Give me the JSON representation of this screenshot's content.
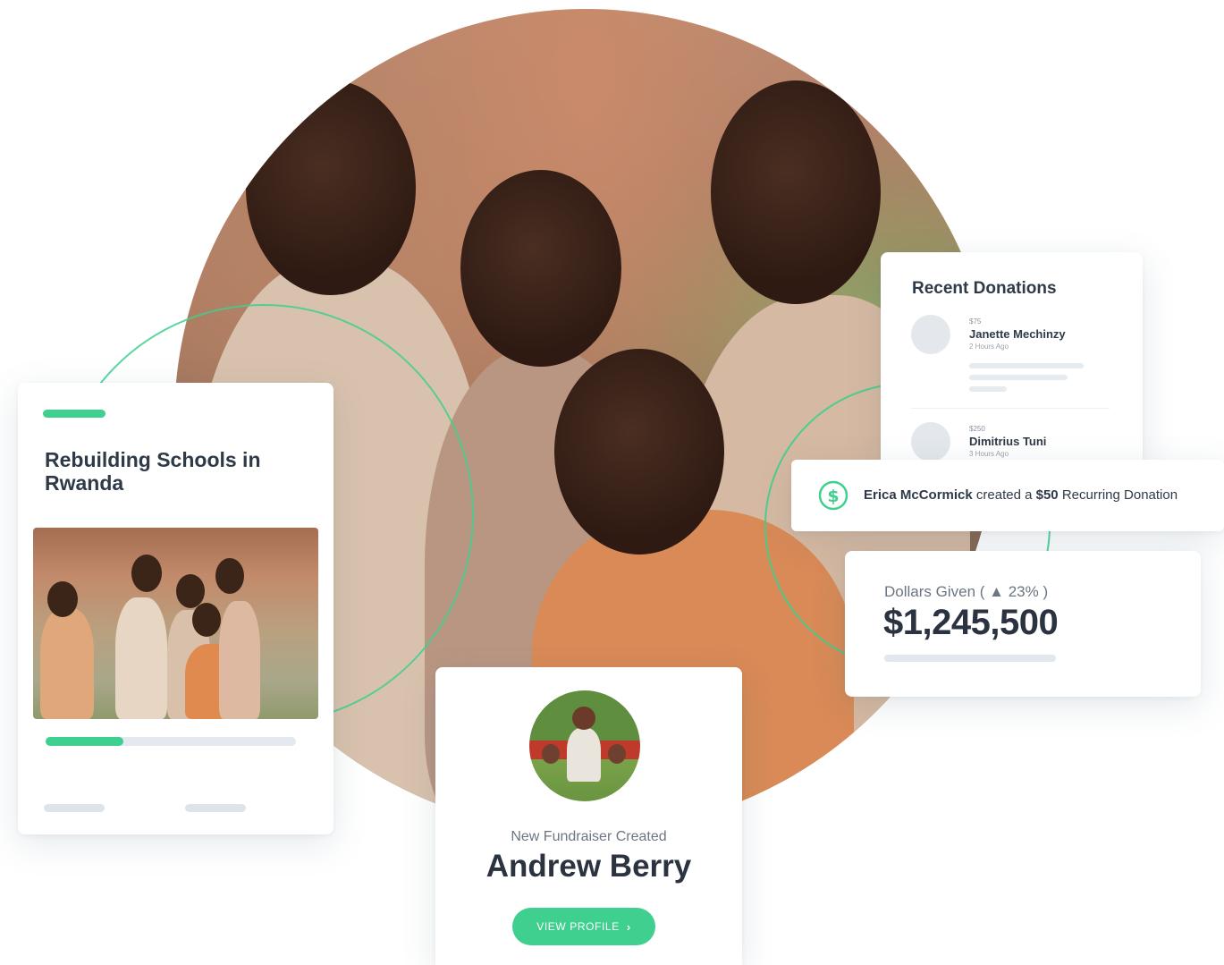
{
  "colors": {
    "accent": "#3fcf8e",
    "text": "#2b3340",
    "muted": "#6b7682",
    "skeleton": "#e1e7ec"
  },
  "campaign": {
    "title": "Rebuilding Schools in Rwanda",
    "progress": 0.31
  },
  "donations": {
    "heading": "Recent Donations",
    "items": [
      {
        "amount": "$75",
        "name": "Janette Mechinzy",
        "time": "2 Hours Ago"
      },
      {
        "amount": "$250",
        "name": "Dimitrius Tuni",
        "time": "3 Hours Ago"
      }
    ]
  },
  "notification": {
    "icon": "dollar-circle-icon",
    "name": "Erica McCormick",
    "middle": " created a ",
    "amount": "$50",
    "suffix": " Recurring Donation"
  },
  "dollars": {
    "label": "Dollars Given ( ▲ 23% )",
    "value": "$1,245,500"
  },
  "fundraiser": {
    "subtitle": "New Fundraiser Created",
    "name": "Andrew Berry",
    "cta": "VIEW PROFILE",
    "cta_icon": "chevron-right-icon"
  }
}
